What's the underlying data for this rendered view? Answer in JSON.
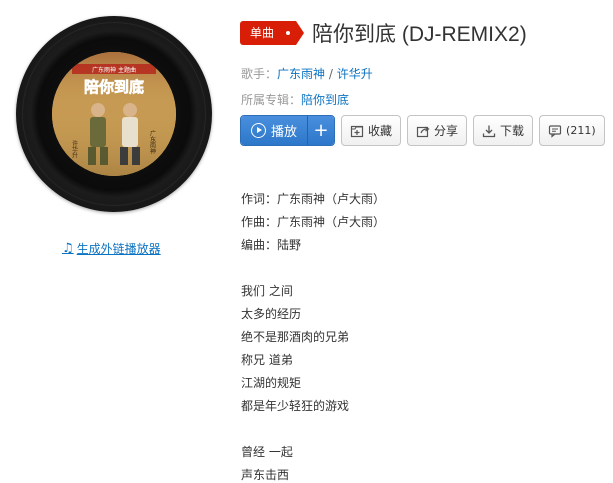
{
  "badge": {
    "label": "单曲"
  },
  "song": {
    "title": "陪你到底 (DJ-REMIX2)"
  },
  "singer": {
    "label": "歌手：",
    "names": [
      "广东雨神",
      "许华升"
    ],
    "separator": " / "
  },
  "album": {
    "label": "所属专辑：",
    "name": "陪你到底"
  },
  "toolbar": {
    "play_label": "播放",
    "add_label": "+",
    "collect_label": "收藏",
    "share_label": "分享",
    "download_label": "下载",
    "comment_count": "(211)"
  },
  "cover": {
    "title_text": "陪你到底",
    "tag_text": "许华升",
    "tag2_text": "广东雨神",
    "top_banner": "广东雨神 主题曲"
  },
  "ext_link": {
    "label": "生成外链播放器"
  },
  "lyrics": {
    "credits": [
      "作词：广东雨神（卢大雨）",
      "作曲：广东雨神（卢大雨）",
      "编曲：陆野"
    ],
    "verse1": [
      "我们 之间",
      "太多的经历",
      "绝不是那酒肉的兄弟",
      "称兄 道弟",
      "江湖的规矩",
      "都是年少轻狂的游戏"
    ],
    "verse2": [
      "曾经 一起",
      "声东击西"
    ]
  },
  "colors": {
    "accent": "#d81e06",
    "link": "#0c73c2",
    "play": "#2c77c9"
  },
  "icons": [
    "play-circle-icon",
    "plus-icon",
    "collect-icon",
    "share-icon",
    "download-icon",
    "comment-icon",
    "music-note-icon"
  ]
}
